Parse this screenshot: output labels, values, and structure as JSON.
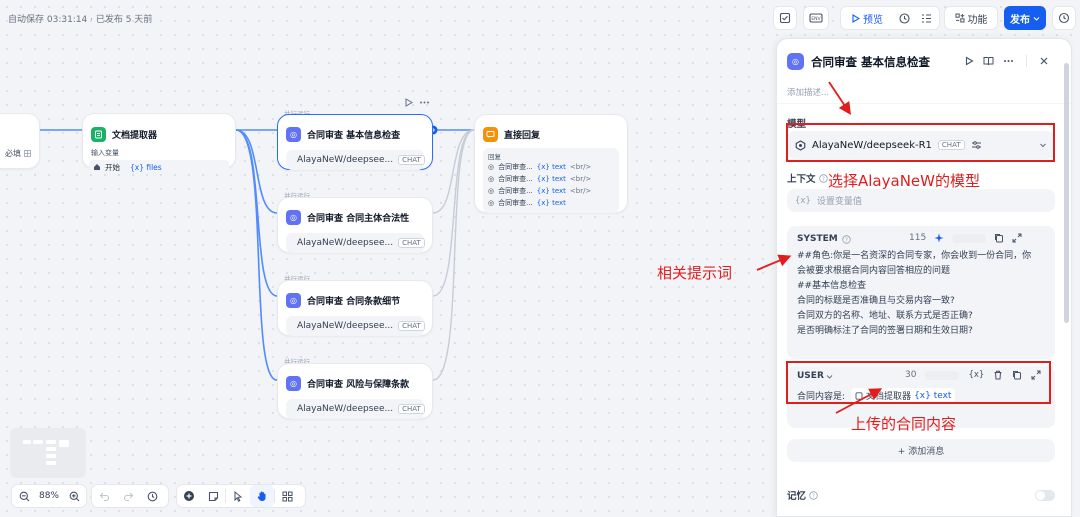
{
  "topbar": {
    "autosave": "自动保存 03:31:14 · 已发布 5 天前",
    "preview_label": "预览",
    "features_label": "功能",
    "publish_label": "发布"
  },
  "canvas": {
    "partial_left_label": "必填",
    "doc_extractor": {
      "title": "文档提取器",
      "input_label": "输入变量",
      "start_label": "开始",
      "var_label": "{x} files"
    },
    "llm_nodes": [
      {
        "parallel": "并行运行",
        "title": "合同审查 基本信息检查",
        "model": "AlayaNeW/deepsee...",
        "tag": "CHAT"
      },
      {
        "parallel": "并行运行",
        "title": "合同审查 合同主体合法性",
        "model": "AlayaNeW/deepsee...",
        "tag": "CHAT"
      },
      {
        "parallel": "并行运行",
        "title": "合同审查 合同条款细节",
        "model": "AlayaNeW/deepsee...",
        "tag": "CHAT"
      },
      {
        "parallel": "并行运行",
        "title": "合同审查 风险与保障条款",
        "model": "AlayaNeW/deepsee...",
        "tag": "CHAT"
      }
    ],
    "answer_node": {
      "title": "直接回复",
      "section_label": "回复",
      "rows": [
        {
          "source": "合同审查...",
          "var": "{x} text",
          "suffix": "<br/>"
        },
        {
          "source": "合同审查...",
          "var": "{x} text",
          "suffix": "<br/>"
        },
        {
          "source": "合同审查...",
          "var": "{x} text",
          "suffix": "<br/>"
        },
        {
          "source": "合同审查...",
          "var": "{x} text",
          "suffix": ""
        }
      ]
    },
    "zoom_level": "88%"
  },
  "panel": {
    "title": "合同审查 基本信息检查",
    "description_placeholder": "添加描述...",
    "model_section": "模型",
    "model_name": "AlayaNeW/deepseek-R1",
    "model_tag": "CHAT",
    "context_label": "上下文",
    "context_placeholder": "设置变量值",
    "system": {
      "label": "SYSTEM",
      "count": "115",
      "lines": [
        "##角色:你是一名资深的合同专家，你会收到一份合同，你",
        "会被要求根据合同内容回答相应的问题",
        "##基本信息检查",
        "合同的标题是否准确且与交易内容一致?",
        "合同双方的名称、地址、联系方式是否正确?",
        "是否明确标注了合同的签署日期和生效日期?"
      ]
    },
    "user": {
      "label": "USER",
      "count": "30",
      "prefix": "合同内容是:",
      "node_ref": "文档提取器",
      "var_ref": "{x} text"
    },
    "add_message_label": "+ 添加消息",
    "memory_label": "记忆"
  },
  "annotations": {
    "model_note": "选择AlayaNeW的模型",
    "prompt_note": "相关提示词",
    "content_note": "上传的合同内容"
  },
  "colors": {
    "accent": "#155eef",
    "annotation_red": "#e11d1d",
    "llm_icon": "#6172f3",
    "doc_icon": "#16b364",
    "answer_icon": "#f79009"
  }
}
